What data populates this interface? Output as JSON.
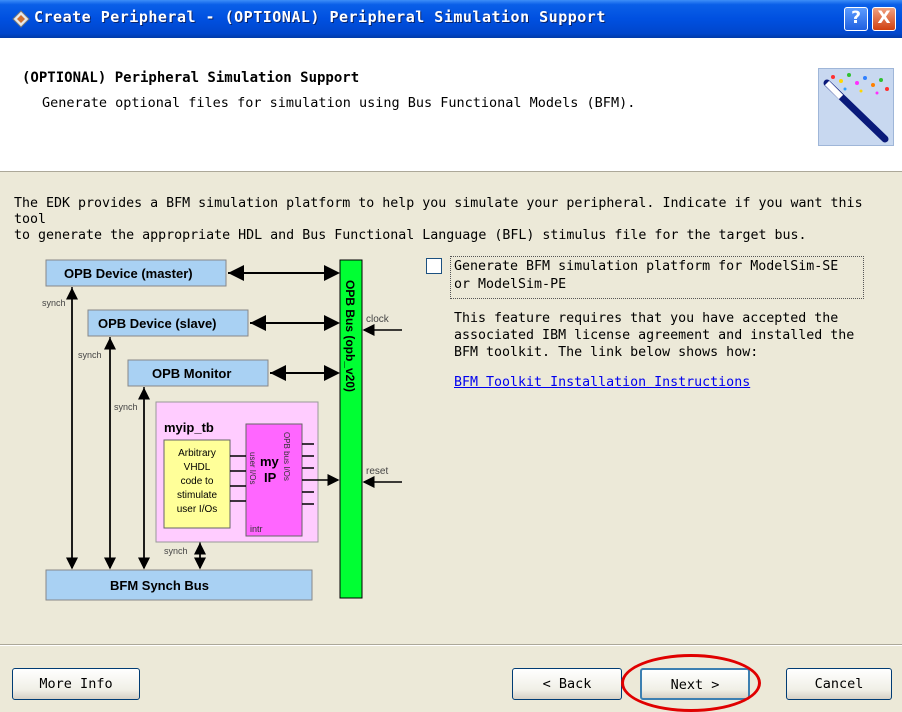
{
  "window": {
    "title": "Create Peripheral - (OPTIONAL) Peripheral Simulation Support",
    "help_label": "?",
    "close_label": "X"
  },
  "header": {
    "title": "(OPTIONAL) Peripheral Simulation Support",
    "subtitle": "Generate optional files for simulation using Bus Functional Models (BFM)."
  },
  "body": {
    "intro_line1": "The EDK provides a BFM simulation platform to help you simulate your peripheral. Indicate if you want this tool",
    "intro_line2": "to generate the appropriate HDL and Bus Functional Language (BFL) stimulus file for the target bus.",
    "checkbox_line1": "Generate BFM simulation platform for ModelSim-SE",
    "checkbox_line2": "or ModelSim-PE",
    "checkbox_checked": false,
    "feature_line1": "This feature requires that you have accepted the",
    "feature_line2": "associated IBM license agreement and installed the",
    "feature_line3": "BFM toolkit. The link below shows how:",
    "link_text": "BFM Toolkit Installation Instructions"
  },
  "diagram": {
    "master": "OPB Device (master)",
    "slave": "OPB Device (slave)",
    "monitor": "OPB Monitor",
    "tb_name": "myip_tb",
    "arb_line1": "Arbitrary",
    "arb_line2": "VHDL",
    "arb_line3": "code to",
    "arb_line4": "stimulate",
    "arb_line5": "user I/Os",
    "ip_line1": "my",
    "ip_line2": "IP",
    "user_ios": "user I/Os",
    "bus_ios": "OPB bus I/Os",
    "intr": "intr",
    "synch": "synch",
    "clock": "clock",
    "reset": "reset",
    "bus_name": "OPB Bus (opb_v20)",
    "synch_bus": "BFM Synch Bus",
    "colors": {
      "box_blue": "#a9d1f3",
      "bus_green": "#00ff33",
      "tb_pink": "#ffccff",
      "ip_magenta": "#ff66ff",
      "arb_yellow": "#ffff99"
    }
  },
  "footer": {
    "more_info": "More Info",
    "back": "< Back",
    "next": "Next >",
    "cancel": "Cancel"
  }
}
